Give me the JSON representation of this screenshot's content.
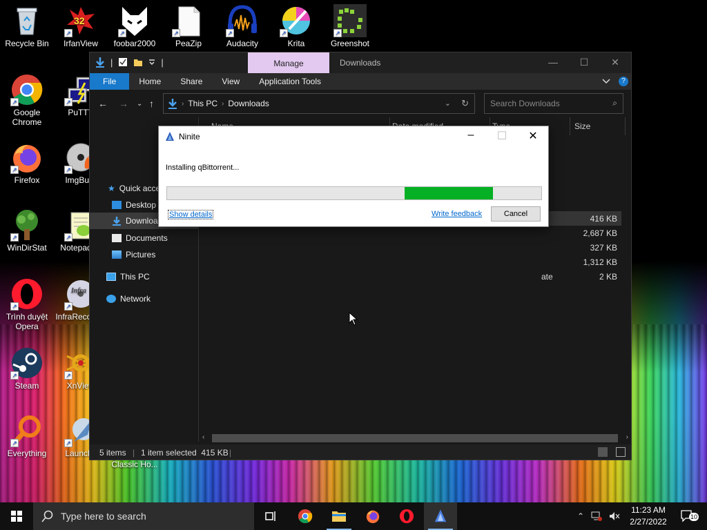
{
  "desktop": {
    "icons": [
      {
        "label": "Recycle Bin",
        "name": "recycle-bin-icon"
      },
      {
        "label": "IrfanView",
        "name": "irfanview-icon"
      },
      {
        "label": "foobar2000",
        "name": "foobar2000-icon"
      },
      {
        "label": "PeaZip",
        "name": "peazip-icon"
      },
      {
        "label": "Audacity",
        "name": "audacity-icon"
      },
      {
        "label": "Krita",
        "name": "krita-icon"
      },
      {
        "label": "Greenshot",
        "name": "greenshot-icon"
      },
      {
        "label": "Google Chrome",
        "name": "chrome-icon"
      },
      {
        "label": "PuTTY",
        "name": "putty-icon"
      },
      {
        "label": "Firefox",
        "name": "firefox-icon"
      },
      {
        "label": "ImgBurn",
        "name": "imgburn-icon"
      },
      {
        "label": "WinDirStat",
        "name": "windirstat-icon"
      },
      {
        "label": "Notepad++",
        "name": "notepadpp-icon"
      },
      {
        "label": "Trình duyệt Opera",
        "name": "opera-icon"
      },
      {
        "label": "InfraRecorder",
        "name": "infrarecorder-icon"
      },
      {
        "label": "Steam",
        "name": "steam-icon"
      },
      {
        "label": "XnView",
        "name": "xnview-icon"
      },
      {
        "label": "Everything",
        "name": "everything-icon"
      },
      {
        "label": "Launchy",
        "name": "launchy-icon"
      },
      {
        "label": "Classic Ho...",
        "name": "classic-shell-label"
      }
    ],
    "irfanview_badge": "32"
  },
  "explorer": {
    "title": "Downloads",
    "manage_tab": "Manage",
    "ribbon_tabs": [
      "File",
      "Home",
      "Share",
      "View",
      "Application Tools"
    ],
    "breadcrumb": [
      "This PC",
      "Downloads"
    ],
    "search_placeholder": "Search Downloads",
    "nav": {
      "quick_access": "Quick access",
      "desktop": "Desktop",
      "downloads": "Downloads",
      "documents": "Documents",
      "pictures": "Pictures",
      "this_pc": "This PC",
      "network": "Network"
    },
    "columns": {
      "name": "Name",
      "date": "Date modified",
      "type": "Type",
      "size": "Size"
    },
    "files": [
      {
        "type": "",
        "size": "416 KB",
        "selected": true
      },
      {
        "type": "",
        "size": "2,687 KB",
        "selected": false
      },
      {
        "type": "",
        "size": "327 KB",
        "selected": false
      },
      {
        "type": "",
        "size": "1,312 KB",
        "selected": false
      },
      {
        "type": "ate",
        "size": "2 KB",
        "selected": false
      }
    ],
    "status": {
      "items": "5 items",
      "selected": "1 item selected  415 KB"
    }
  },
  "ninite": {
    "title": "Ninite",
    "status": "Installing qBittorrent...",
    "progress": {
      "start": 0.635,
      "end": 0.87
    },
    "show_details": "Show details",
    "write_feedback": "Write feedback",
    "cancel": "Cancel"
  },
  "taskbar": {
    "search_placeholder": "Type here to search",
    "time": "11:23 AM",
    "date": "2/27/2022",
    "notification_count": "10"
  },
  "colors": {
    "accent": "#1979ca",
    "progress_fill": "#06b025",
    "manage_tab": "#e3c9f0"
  }
}
